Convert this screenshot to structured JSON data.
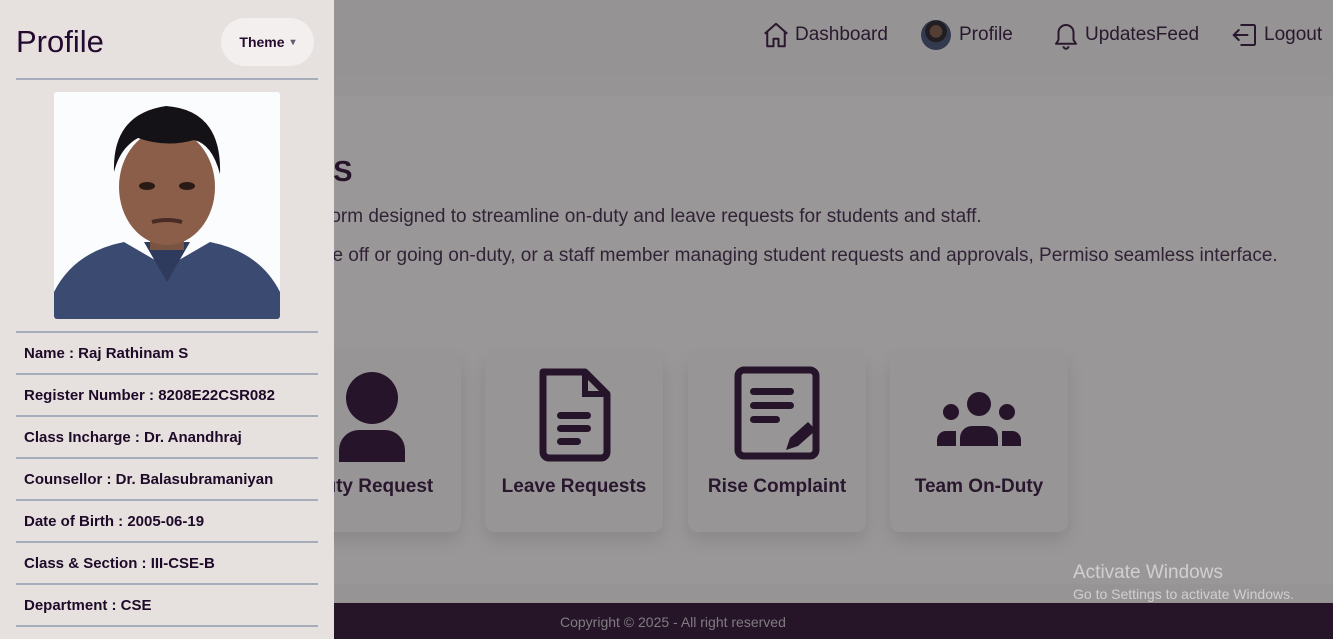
{
  "nav": {
    "dashboard": "Dashboard",
    "profile": "Profile",
    "updates": "UpdatesFeed",
    "logout": "Logout"
  },
  "hero": {
    "title": "thinam S",
    "paragraph1": "-in-one platform designed to streamline on-duty and leave requests for students and staff.",
    "paragraph2": "questing time off or going on-duty, or a staff member managing student requests and approvals, Permiso seamless interface."
  },
  "cards": [
    {
      "label": "Duty Request",
      "icon": "user-icon"
    },
    {
      "label": "Leave Requests",
      "icon": "document-icon"
    },
    {
      "label": "Rise Complaint",
      "icon": "edit-document-icon"
    },
    {
      "label": "Team On-Duty",
      "icon": "users-icon"
    }
  ],
  "footer": {
    "copyright": "Copyright © 2025 - All right reserved"
  },
  "watermark": {
    "title": "Activate Windows",
    "subtitle": "Go to Settings to activate Windows."
  },
  "drawer": {
    "title": "Profile",
    "theme_label": "Theme",
    "info": [
      "Name : Raj Rathinam S",
      "Register Number : 8208E22CSR082",
      "Class Incharge : Dr. Anandhraj",
      "Counsellor : Dr. Balasubramaniyan",
      "Date of Birth : 2005-06-19",
      "Class & Section : III-CSE-B",
      "Department : CSE"
    ]
  },
  "colors": {
    "primary": "#25082f",
    "footer": "#25082a",
    "drawer": "#e6e1df"
  }
}
